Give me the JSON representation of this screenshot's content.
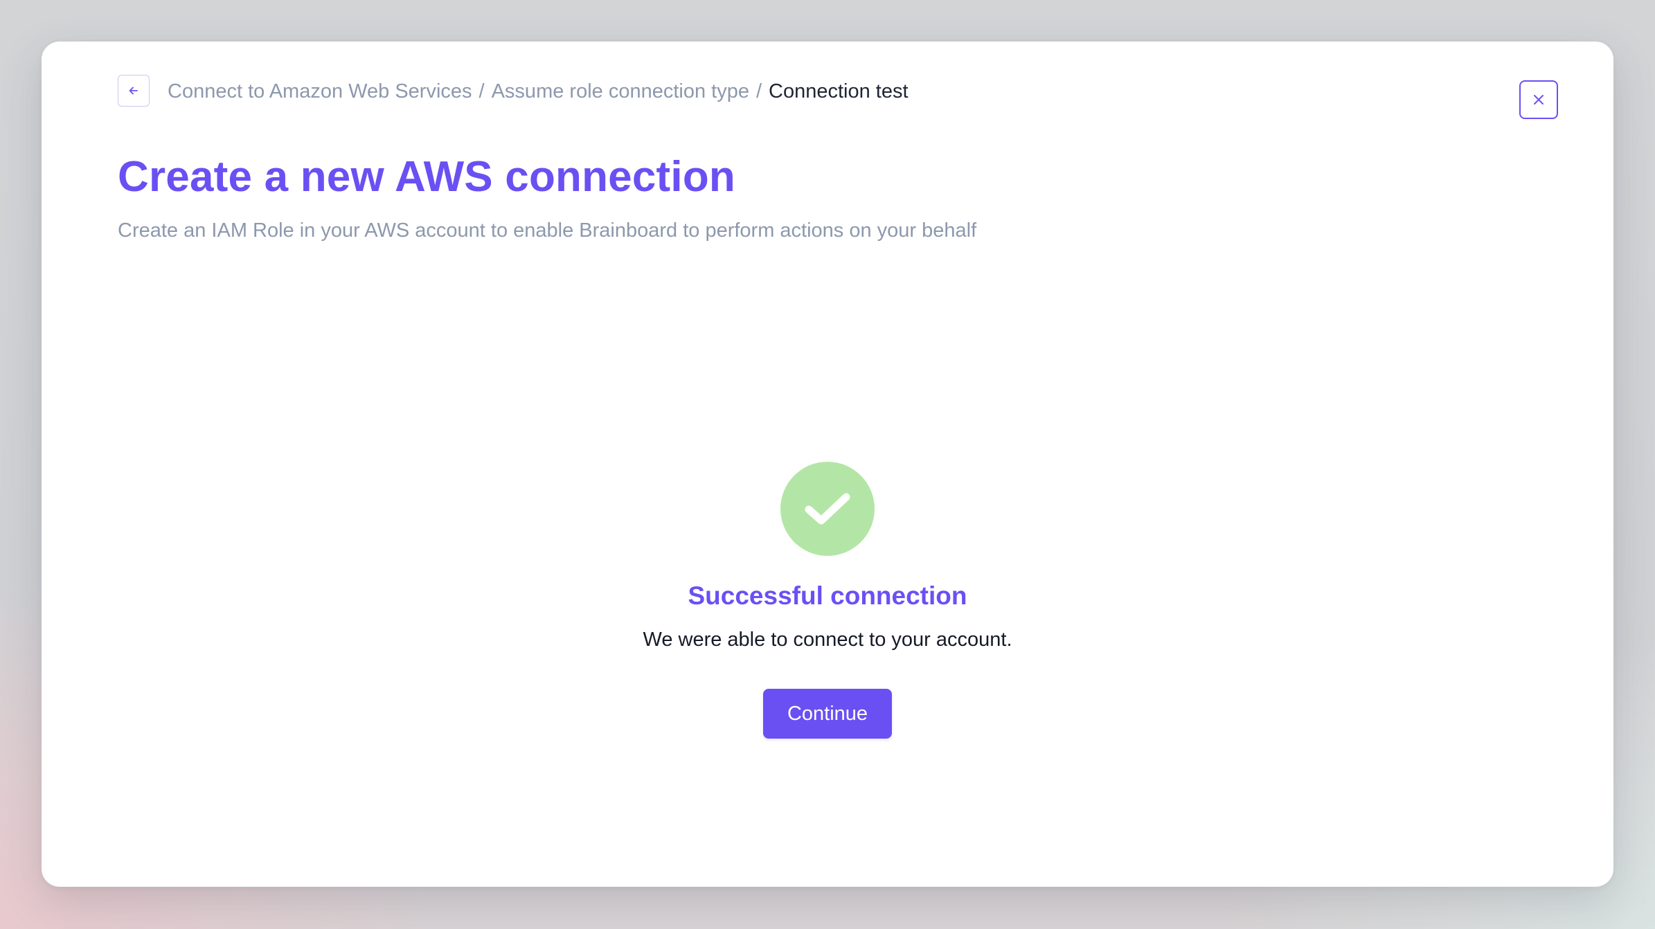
{
  "colors": {
    "accent": "#6a50f3",
    "muted_text": "#8d98ad",
    "body_text": "#161a26",
    "success_circle": "#b3e6a6",
    "surface": "#ffffff"
  },
  "header": {
    "back_icon": "arrow-left-icon",
    "close_icon": "close-icon",
    "breadcrumb": [
      {
        "label": "Connect to Amazon Web Services"
      },
      {
        "label": "Assume role connection type"
      },
      {
        "label": "Connection test",
        "current": true
      }
    ],
    "separator": "/"
  },
  "page": {
    "title": "Create a new AWS connection",
    "subtitle": "Create an IAM Role in your AWS account to enable Brainboard to perform actions on your behalf"
  },
  "result": {
    "icon": "checkmark-icon",
    "title": "Successful connection",
    "message": "We were able to connect to your account.",
    "continue_label": "Continue"
  }
}
